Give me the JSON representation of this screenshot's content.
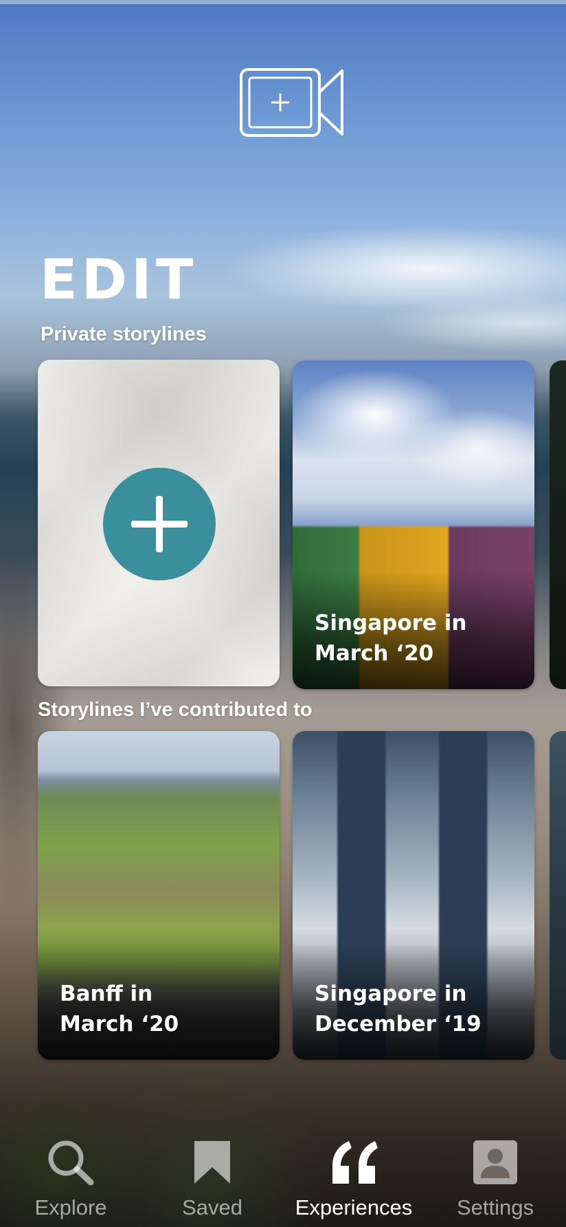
{
  "header": {
    "camera_icon": "video-camera-add-icon"
  },
  "page_title": "EDIT",
  "private_section": {
    "label": "Private storylines",
    "add_icon": "plus-circle-icon",
    "cards": [
      {
        "title": "Singapore in\nMarch ‘20"
      }
    ]
  },
  "contributed_section": {
    "label": "Storylines I’ve contributed to",
    "cards": [
      {
        "title": "Banff in\nMarch ‘20"
      },
      {
        "title": "Singapore in\nDecember ‘19"
      }
    ]
  },
  "tabbar": {
    "active": "Experiences",
    "tabs": [
      {
        "label": "Explore",
        "icon": "search-icon"
      },
      {
        "label": "Saved",
        "icon": "bookmark-icon"
      },
      {
        "label": "Experiences",
        "icon": "quote-icon"
      },
      {
        "label": "Settings",
        "icon": "profile-icon"
      }
    ]
  },
  "colors": {
    "accent": "#3b8f9c",
    "text": "#ffffff"
  }
}
